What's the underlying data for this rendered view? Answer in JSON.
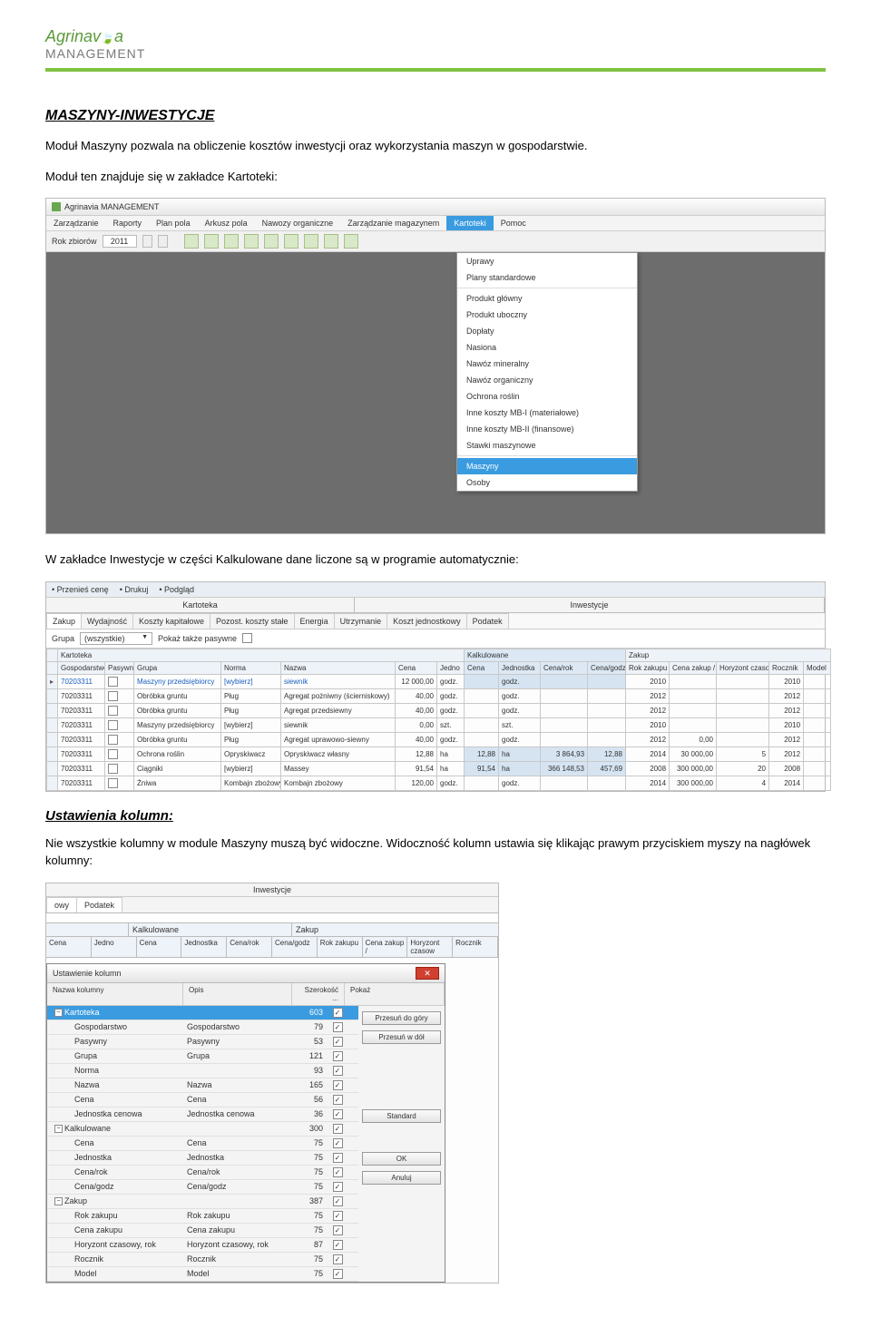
{
  "logo": {
    "line1_pre": "Agrinav",
    "line1_suf": "a",
    "line2": "MANAGEMENT"
  },
  "page": {
    "h1": "MASZYNY-INWESTYCJE",
    "p1": "Moduł Maszyny pozwala na obliczenie kosztów inwestycji oraz wykorzystania maszyn w gospodarstwie.",
    "p2": "Moduł ten znajduje się w zakładce Kartoteki:",
    "p3": "W zakładce Inwestycje w części Kalkulowane dane liczone są w programie automatycznie:",
    "h2": "Ustawienia kolumn:",
    "p4": "Nie wszystkie kolumny w module Maszyny muszą być widoczne. Widoczność kolumn ustawia się klikając prawym przyciskiem myszy na nagłówek kolumny:"
  },
  "shot1": {
    "title": "Agrinavia MANAGEMENT",
    "menus": [
      "Zarządzanie",
      "Raporty",
      "Plan pola",
      "Arkusz pola",
      "Nawozy organiczne",
      "Zarządzanie magazynem",
      "Kartoteki",
      "Pomoc"
    ],
    "active_menu": 6,
    "rok_label": "Rok zbiorów",
    "rok_val": "2011",
    "dropdown": {
      "groups": [
        [
          "Uprawy",
          "Plany standardowe"
        ],
        [
          "Produkt główny",
          "Produkt uboczny",
          "Dopłaty",
          "Nasiona",
          "Nawóz mineralny",
          "Nawóz organiczny",
          "Ochrona roślin",
          "Inne koszty MB-I (materiałowe)",
          "Inne koszty MB-II (finansowe)",
          "Stawki maszynowe"
        ],
        [
          "Maszyny",
          "Osoby"
        ]
      ],
      "selected": "Maszyny"
    }
  },
  "shot2": {
    "toolbar": [
      "• Przenieś cenę",
      "• Drukuj",
      "• Podgląd"
    ],
    "sections": [
      "Kartoteka",
      "Inwestycje"
    ],
    "subtabs": [
      "Zakup",
      "Wydajność",
      "Koszty kapitałowe",
      "Pozost. koszty stałe",
      "Energia",
      "Utrzymanie",
      "Koszt jednostkowy",
      "Podatek"
    ],
    "group_label": "Grupa",
    "group_val": "(wszystkie)",
    "show_also": "Pokaż także pasywne",
    "col_sections": [
      "Kartoteka",
      "Kalkulowane",
      "Zakup"
    ],
    "columns": [
      "Gospodarstwo",
      "Pasywny",
      "Grupa",
      "Norma",
      "Nazwa",
      "Cena",
      "Jedno",
      "Cena",
      "Jednostka",
      "Cena/rok",
      "Cena/godz",
      "Rok zakupu",
      "Cena zakup /",
      "Horyzont czasow",
      "Rocznik",
      "Model"
    ],
    "rows": [
      {
        "g": "70203311",
        "grp": "Maszyny przedsiębiorcy",
        "norm": "[wybierz]",
        "naz": "siewnik",
        "c": "12 000,00",
        "j": "godz.",
        "c2": "",
        "j2": "godz.",
        "crok": "",
        "cg": "",
        "rz": "2010",
        "cz": "",
        "hc": "",
        "roc": "2010",
        "m": "",
        "link": true,
        "blue": true
      },
      {
        "g": "70203311",
        "grp": "Obróbka gruntu",
        "norm": "Pług",
        "naz": "Agregat pożniwny (ścierniskowy)",
        "c": "40,00",
        "j": "godz.",
        "c2": "",
        "j2": "godz.",
        "crok": "",
        "cg": "",
        "rz": "2012",
        "cz": "",
        "hc": "",
        "roc": "2012",
        "m": ""
      },
      {
        "g": "70203311",
        "grp": "Obróbka gruntu",
        "norm": "Pług",
        "naz": "Agregat przedsiewny",
        "c": "40,00",
        "j": "godz.",
        "c2": "",
        "j2": "godz.",
        "crok": "",
        "cg": "",
        "rz": "2012",
        "cz": "",
        "hc": "",
        "roc": "2012",
        "m": ""
      },
      {
        "g": "70203311",
        "grp": "Maszyny przedsiębiorcy",
        "norm": "[wybierz]",
        "naz": "siewnik",
        "c": "0,00",
        "j": "szt.",
        "c2": "",
        "j2": "szt.",
        "crok": "",
        "cg": "",
        "rz": "2010",
        "cz": "",
        "hc": "",
        "roc": "2010",
        "m": ""
      },
      {
        "g": "70203311",
        "grp": "Obróbka gruntu",
        "norm": "Pług",
        "naz": "Agregat uprawowo-siewny",
        "c": "40,00",
        "j": "godz.",
        "c2": "",
        "j2": "godz.",
        "crok": "",
        "cg": "",
        "rz": "2012",
        "cz": "0,00",
        "hc": "",
        "roc": "2012",
        "m": ""
      },
      {
        "g": "70203311",
        "grp": "Ochrona roślin",
        "norm": "Opryskiwacz",
        "naz": "Opryskiwacz własny",
        "c": "12,88",
        "j": "ha",
        "c2": "12,88",
        "j2": "ha",
        "crok": "3 864,93",
        "cg": "12,88",
        "rz": "2014",
        "cz": "30 000,00",
        "hc": "5",
        "roc": "2012",
        "m": "",
        "blue": true
      },
      {
        "g": "70203311",
        "grp": "Ciągniki",
        "norm": "[wybierz]",
        "naz": "Massey",
        "c": "91,54",
        "j": "ha",
        "c2": "91,54",
        "j2": "ha",
        "crok": "366 148,53",
        "cg": "457,69",
        "rz": "2008",
        "cz": "300 000,00",
        "hc": "20",
        "roc": "2008",
        "m": "",
        "blue": true
      },
      {
        "g": "70203311",
        "grp": "Żniwa",
        "norm": "Kombajn zbożowy",
        "naz": "Kombajn zbożowy",
        "c": "120,00",
        "j": "godz.",
        "c2": "",
        "j2": "godz.",
        "crok": "",
        "cg": "",
        "rz": "2014",
        "cz": "300 000,00",
        "hc": "4",
        "roc": "2014",
        "m": ""
      }
    ]
  },
  "shot3": {
    "inv_label": "Inwestycje",
    "tabs": [
      "owy",
      "Podatek"
    ],
    "sections": [
      "Kalkulowane",
      "Zakup"
    ],
    "cols": [
      "Cena",
      "Jedno",
      "Cena",
      "Jednostka",
      "Cena/rok",
      "Cena/godz",
      "Rok zakupu",
      "Cena zakup /",
      "Horyzont czasow",
      "Rocznik"
    ],
    "dialog_title": "Ustawienie kolumn",
    "hdr": [
      "Nazwa kolumny",
      "Opis",
      "Szerokość ...",
      "Pokaż"
    ],
    "buttons": [
      "Przesuń do góry",
      "Przesuń w dół",
      "Standard",
      "OK",
      "Anuluj"
    ],
    "tree": [
      {
        "l": 0,
        "exp": "-",
        "n": "Kartoteka",
        "o": "",
        "w": "603",
        "chk": true,
        "sel": true
      },
      {
        "l": 1,
        "n": "Gospodarstwo",
        "o": "Gospodarstwo",
        "w": "79",
        "chk": true
      },
      {
        "l": 1,
        "n": "Pasywny",
        "o": "Pasywny",
        "w": "53",
        "chk": true
      },
      {
        "l": 1,
        "n": "Grupa",
        "o": "Grupa",
        "w": "121",
        "chk": true
      },
      {
        "l": 1,
        "n": "Norma",
        "o": "",
        "w": "93",
        "chk": true
      },
      {
        "l": 1,
        "n": "Nazwa",
        "o": "Nazwa",
        "w": "165",
        "chk": true
      },
      {
        "l": 1,
        "n": "Cena",
        "o": "Cena",
        "w": "56",
        "chk": true
      },
      {
        "l": 1,
        "n": "Jednostka cenowa",
        "o": "Jednostka cenowa",
        "w": "36",
        "chk": true
      },
      {
        "l": 0,
        "exp": "-",
        "n": "Kalkulowane",
        "o": "",
        "w": "300",
        "chk": true
      },
      {
        "l": 1,
        "n": "Cena",
        "o": "Cena",
        "w": "75",
        "chk": true
      },
      {
        "l": 1,
        "n": "Jednostka",
        "o": "Jednostka",
        "w": "75",
        "chk": true
      },
      {
        "l": 1,
        "n": "Cena/rok",
        "o": "Cena/rok",
        "w": "75",
        "chk": true
      },
      {
        "l": 1,
        "n": "Cena/godz",
        "o": "Cena/godz",
        "w": "75",
        "chk": true
      },
      {
        "l": 0,
        "exp": "-",
        "n": "Zakup",
        "o": "",
        "w": "387",
        "chk": true
      },
      {
        "l": 1,
        "n": "Rok zakupu",
        "o": "Rok zakupu",
        "w": "75",
        "chk": true
      },
      {
        "l": 1,
        "n": "Cena zakupu",
        "o": "Cena zakupu",
        "w": "75",
        "chk": true
      },
      {
        "l": 1,
        "n": "Horyzont czasowy, rok",
        "o": "Horyzont czasowy, rok",
        "w": "87",
        "chk": true
      },
      {
        "l": 1,
        "n": "Rocznik",
        "o": "Rocznik",
        "w": "75",
        "chk": true
      },
      {
        "l": 1,
        "n": "Model",
        "o": "Model",
        "w": "75",
        "chk": true
      }
    ]
  }
}
